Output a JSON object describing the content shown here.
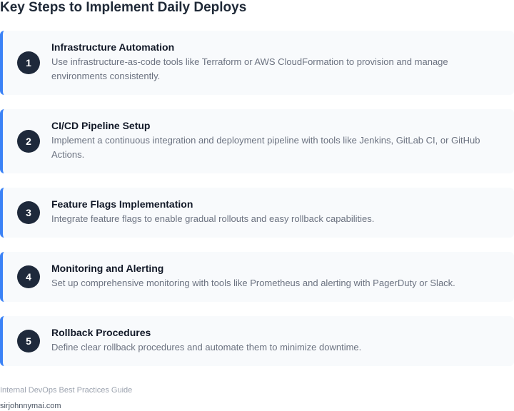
{
  "title": "Key Steps to Implement Daily Deploys",
  "steps": [
    {
      "number": "1",
      "title": "Infrastructure Automation",
      "description": "Use infrastructure-as-code tools like Terraform or AWS CloudFormation to provision and manage environments consistently."
    },
    {
      "number": "2",
      "title": "CI/CD Pipeline Setup",
      "description": "Implement a continuous integration and deployment pipeline with tools like Jenkins, GitLab CI, or GitHub Actions."
    },
    {
      "number": "3",
      "title": "Feature Flags Implementation",
      "description": "Integrate feature flags to enable gradual rollouts and easy rollback capabilities."
    },
    {
      "number": "4",
      "title": "Monitoring and Alerting",
      "description": "Set up comprehensive monitoring with tools like Prometheus and alerting with PagerDuty or Slack."
    },
    {
      "number": "5",
      "title": "Rollback Procedures",
      "description": "Define clear rollback procedures and automate them to minimize downtime."
    }
  ],
  "footer": {
    "note": "Internal DevOps Best Practices Guide",
    "site": "sirjohnnymai.com"
  },
  "colors": {
    "accent": "#3b82f6",
    "badge": "#1e293b",
    "card_bg": "#f8fafc"
  }
}
